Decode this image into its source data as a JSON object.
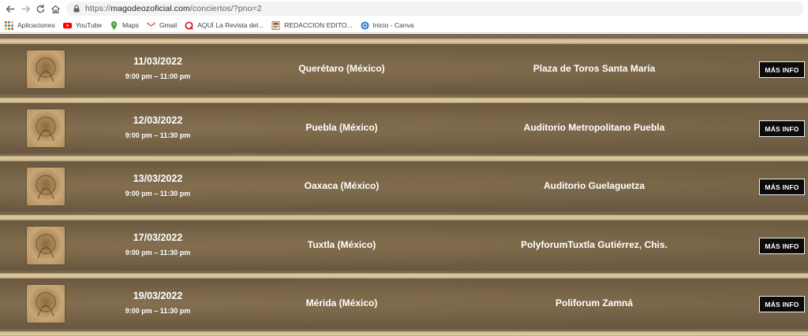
{
  "browser": {
    "url_prefix": "https://",
    "url_host": "magodeozoficial.com",
    "url_path": "/conciertos/?pno=2",
    "bookmarks": [
      {
        "label": "Aplicaciones",
        "icon": "apps-grid-icon"
      },
      {
        "label": "YouTube",
        "icon": "youtube-icon"
      },
      {
        "label": "Maps",
        "icon": "maps-pin-icon"
      },
      {
        "label": "Gmail",
        "icon": "gmail-icon"
      },
      {
        "label": "AQUÍ La Revista del...",
        "icon": "q-icon"
      },
      {
        "label": "REDACCION EDITO...",
        "icon": "document-icon"
      },
      {
        "label": "Inicio - Canva",
        "icon": "canva-icon"
      }
    ]
  },
  "concerts": [
    {
      "date": "11/03/2022",
      "time": "9:00 pm – 11:00 pm",
      "city": "Querétaro (México)",
      "venue": "Plaza de Toros Santa María",
      "button": "MÁS INFO"
    },
    {
      "date": "12/03/2022",
      "time": "9:00 pm – 11:30 pm",
      "city": "Puebla (México)",
      "venue": "Auditorio Metropolitano Puebla",
      "button": "MÁS INFO"
    },
    {
      "date": "13/03/2022",
      "time": "9:00 pm – 11:30 pm",
      "city": "Oaxaca (México)",
      "venue": "Auditorio Guelaguetza",
      "button": "MÁS INFO"
    },
    {
      "date": "17/03/2022",
      "time": "9:00 pm – 11:30 pm",
      "city": "Tuxtla (México)",
      "venue": "PolyforumTuxtla Gutiérrez, Chis.",
      "button": "MÁS INFO"
    },
    {
      "date": "19/03/2022",
      "time": "9:00 pm – 11:30 pm",
      "city": "Mérida (México)",
      "venue": "Poliforum Zamná",
      "button": "MÁS INFO"
    }
  ],
  "colors": {
    "button_bg": "#0b0b0b",
    "stripe": "#e3cfa6",
    "text": "#ffffff"
  }
}
